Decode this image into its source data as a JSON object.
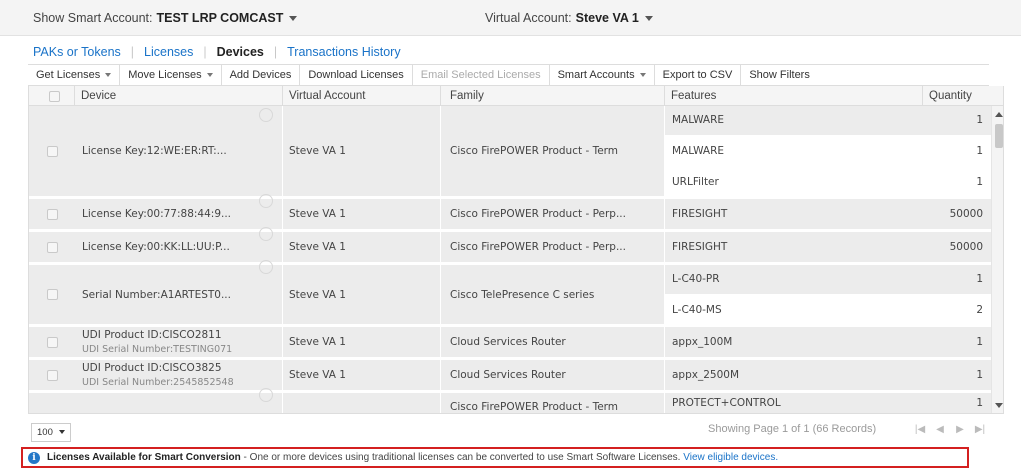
{
  "header": {
    "smart_account_label": "Show Smart Account:",
    "smart_account_value": "TEST LRP COMCAST",
    "virtual_account_label": "Virtual Account:",
    "virtual_account_value": "Steve VA 1"
  },
  "tabs": [
    {
      "label": "PAKs or Tokens"
    },
    {
      "label": "Licenses"
    },
    {
      "label": "Devices"
    },
    {
      "label": "Transactions History"
    }
  ],
  "toolbar": [
    {
      "label": "Get Licenses"
    },
    {
      "label": "Move Licenses"
    },
    {
      "label": "Add Devices"
    },
    {
      "label": "Download Licenses"
    },
    {
      "label": "Email Selected Licenses"
    },
    {
      "label": "Smart Accounts"
    },
    {
      "label": "Export to CSV"
    },
    {
      "label": "Show Filters"
    }
  ],
  "table": {
    "columns": [
      "Device",
      "Virtual Account",
      "Family",
      "Features",
      "Quantity"
    ],
    "rows": [
      {
        "device": "License Key:12:WE:ER:RT:...",
        "device_sub": "",
        "virtual_account": "Steve VA 1",
        "family": "Cisco FirePOWER Product - Term",
        "features": [
          "MALWARE",
          "MALWARE",
          "URLFilter"
        ],
        "quantities": [
          "1",
          "1",
          "1"
        ]
      },
      {
        "device": "License Key:00:77:88:44:9...",
        "device_sub": "",
        "virtual_account": "Steve VA 1",
        "family": "Cisco FirePOWER Product - Perp...",
        "features": [
          "FIRESIGHT"
        ],
        "quantities": [
          "50000"
        ]
      },
      {
        "device": "License Key:00:KK:LL:UU:P...",
        "device_sub": "",
        "virtual_account": "Steve VA 1",
        "family": "Cisco FirePOWER Product - Perp...",
        "features": [
          "FIRESIGHT"
        ],
        "quantities": [
          "50000"
        ]
      },
      {
        "device": "Serial Number:A1ARTEST0...",
        "device_sub": "",
        "virtual_account": "Steve VA 1",
        "family": "Cisco TelePresence C series",
        "features": [
          "L-C40-PR",
          "L-C40-MS"
        ],
        "quantities": [
          "1",
          "2"
        ]
      },
      {
        "device": "UDI Product ID:CISCO2811",
        "device_sub": "UDI Serial Number:TESTING071",
        "virtual_account": "Steve VA 1",
        "family": "Cloud Services Router",
        "features": [
          "appx_100M"
        ],
        "quantities": [
          "1"
        ]
      },
      {
        "device": "UDI Product ID:CISCO3825",
        "device_sub": "UDI Serial Number:2545852548",
        "virtual_account": "Steve VA 1",
        "family": "Cloud Services Router",
        "features": [
          "appx_2500M"
        ],
        "quantities": [
          "1"
        ]
      },
      {
        "device": "",
        "device_sub": "",
        "virtual_account": "",
        "family": "Cisco FirePOWER Product - Term",
        "features": [
          "PROTECT+CONTROL"
        ],
        "quantities": [
          "1"
        ]
      }
    ]
  },
  "pager": {
    "page_size": "100",
    "info": "Showing Page 1 of 1 (66 Records)"
  },
  "notice": {
    "icon": "info-icon",
    "title": "Licenses Available for Smart Conversion",
    "message": " - One or more devices using traditional licenses can be converted to use Smart Software Licenses. ",
    "link": "View eligible devices."
  },
  "colors": {
    "accent": "#1a73c8",
    "alert_border": "#d42020",
    "row_bg": "#ececec"
  }
}
